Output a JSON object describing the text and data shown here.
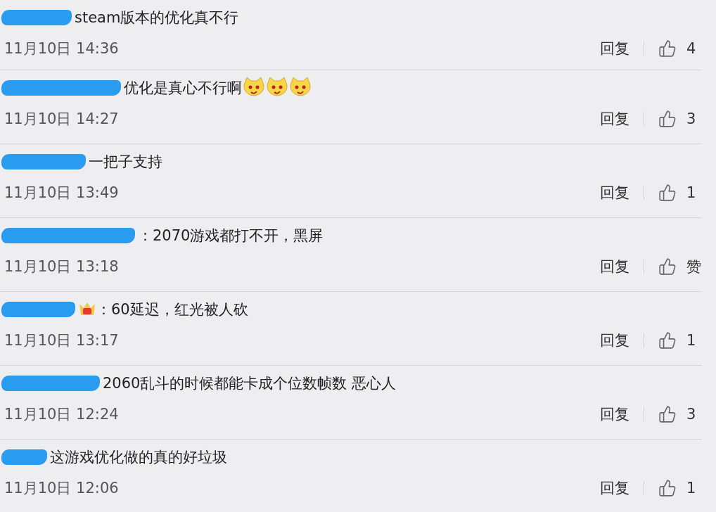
{
  "comments": [
    {
      "text": "steam版本的优化真不行",
      "time": "11月10日 14:36",
      "reply": "回复",
      "likes": "4"
    },
    {
      "text": "优化是真心不行啊",
      "suffix_emoji": [
        {
          "kind": "cat"
        },
        {
          "kind": "cat"
        },
        {
          "kind": "cat"
        }
      ],
      "time": "11月10日 14:27",
      "reply": "回复",
      "likes": "3"
    },
    {
      "text": "一把子支持",
      "time": "11月10日 13:49",
      "reply": "回复",
      "likes": "1"
    },
    {
      "text": "：2070游戏都打不开，黑屏",
      "time": "11月10日 13:18",
      "reply": "回复",
      "likes": "赞"
    },
    {
      "badge": {
        "kind": "crown"
      },
      "text": "：60延迟，红光被人砍",
      "time": "11月10日 13:17",
      "reply": "回复",
      "likes": "1"
    },
    {
      "text": "2060乱斗的时候都能卡成个位数帧数 恶心人",
      "time": "11月10日 12:24",
      "reply": "回复",
      "likes": "3"
    },
    {
      "text": "这游戏优化做的真的好垃圾",
      "time": "11月10日 12:06",
      "reply": "回复",
      "likes": "1"
    }
  ]
}
